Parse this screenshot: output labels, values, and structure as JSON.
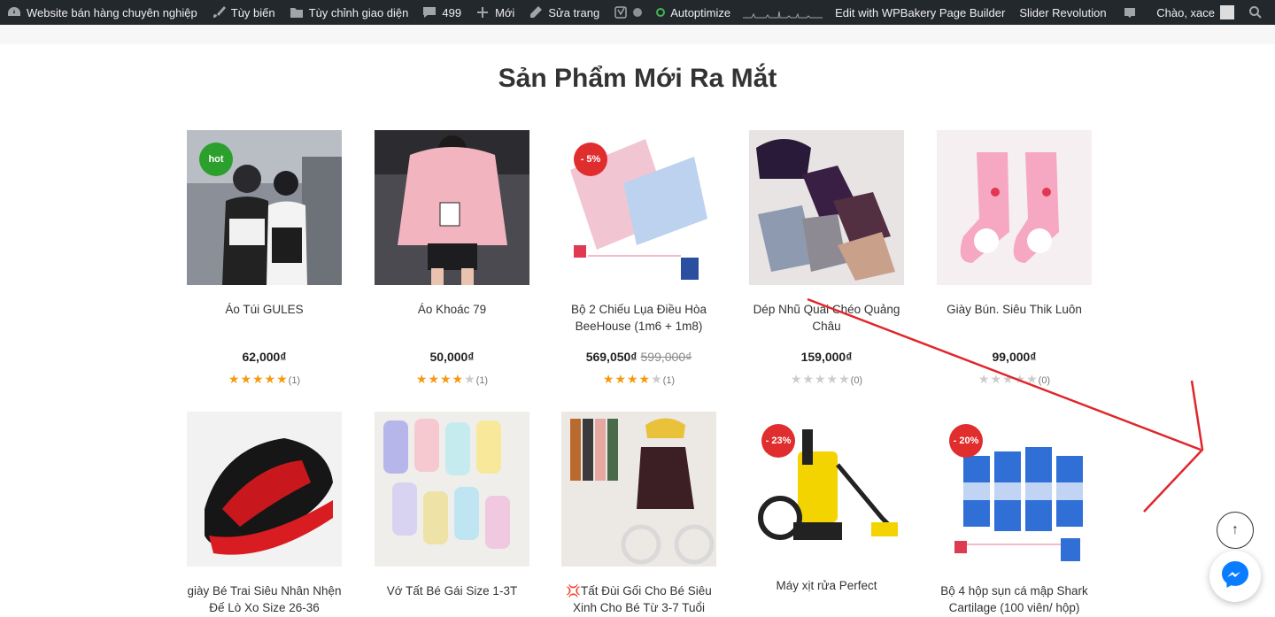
{
  "adminbar": {
    "site_name": "Website bán hàng chuyên nghiệp",
    "customize": "Tùy biến",
    "theme_options": "Tùy chỉnh giao diện",
    "comments_count": "499",
    "new_label": "Mới",
    "edit_page": "Sửa trang",
    "autoptimize": "Autoptimize",
    "wpbakery": "Edit with WPBakery Page Builder",
    "slider_revolution": "Slider Revolution",
    "greeting": "Chào, xace"
  },
  "section": {
    "title": "Sản Phẩm Mới Ra Mắt"
  },
  "products": [
    {
      "name": "Áo Túi GULES",
      "price": "62,000₫",
      "old_price": "",
      "badge": "hot",
      "rating": 5,
      "reviews": "(1)"
    },
    {
      "name": "Áo Khoác 79",
      "price": "50,000₫",
      "old_price": "",
      "badge": "",
      "rating": 4,
      "reviews": "(1)"
    },
    {
      "name": "Bộ 2 Chiếu Lụa Điều Hòa BeeHouse (1m6 + 1m8)",
      "price": "569,050₫",
      "old_price": "599,000₫",
      "badge": "- 5%",
      "rating": 4,
      "reviews": "(1)"
    },
    {
      "name": "Dép Nhũ Quai Chéo Quảng Châu",
      "price": "159,000₫",
      "old_price": "",
      "badge": "",
      "rating": 0,
      "reviews": "(0)"
    },
    {
      "name": "Giày Bún. Siêu Thik Luôn",
      "price": "99,000₫",
      "old_price": "",
      "badge": "",
      "rating": 0,
      "reviews": "(0)"
    },
    {
      "name": "giày Bé Trai Siêu Nhân Nhện Đế Lò Xo Size 26-36",
      "badge": ""
    },
    {
      "name": "Vớ Tất Bé Gái Size 1-3T",
      "badge": ""
    },
    {
      "name": "💢Tất Đùi Gối Cho Bé Siêu Xinh Cho Bé Từ 3-7 Tuổi",
      "badge": ""
    },
    {
      "name": "Máy xịt rửa Perfect",
      "badge": "- 23%"
    },
    {
      "name": "Bộ 4 hộp sụn cá mập Shark Cartilage (100 viên/ hộp)",
      "badge": "- 20%"
    }
  ],
  "colors": {
    "adminbar": "#23282d",
    "hot": "#2ca02c",
    "sale": "#e02d2d",
    "star": "#f59a10",
    "annotation_arrow": "#e0262b"
  }
}
